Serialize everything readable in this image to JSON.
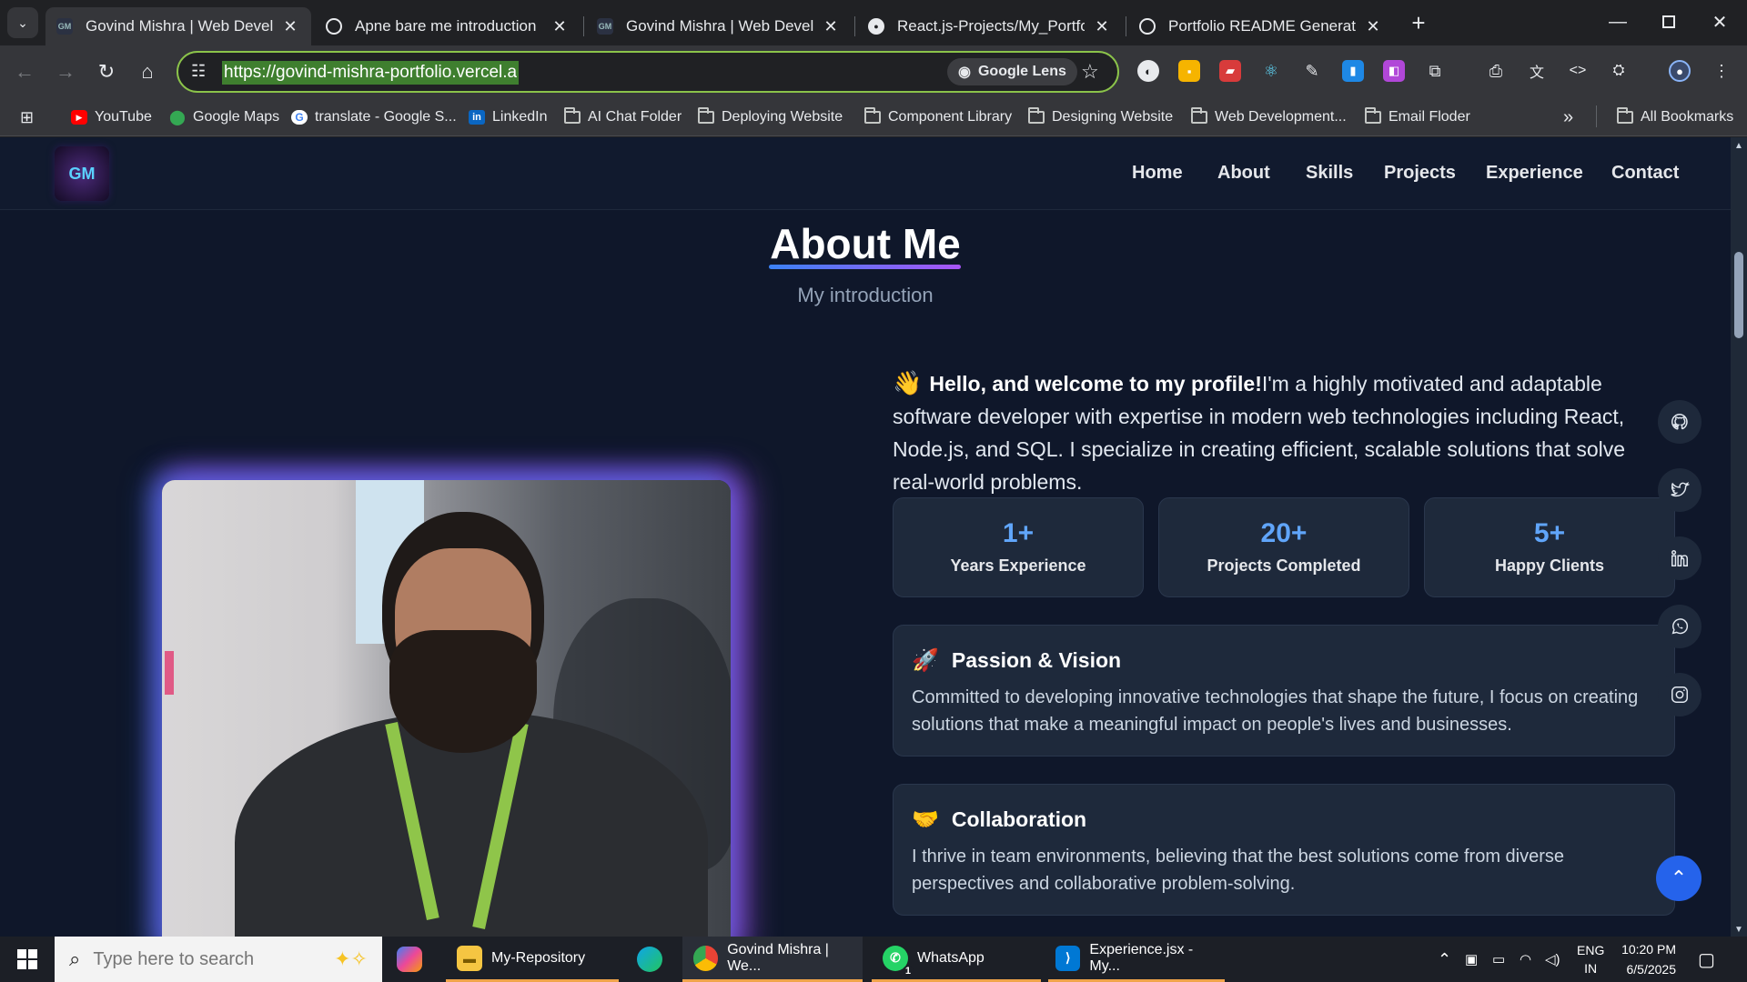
{
  "browser": {
    "tabs": [
      {
        "title": "Govind Mishra | Web Developer",
        "active": true,
        "favicon": "gm-icon"
      },
      {
        "title": "Apne bare me introduction",
        "active": false,
        "favicon": "chatgpt-icon"
      },
      {
        "title": "Govind Mishra | Web Developer",
        "active": false,
        "favicon": "gm-icon"
      },
      {
        "title": "React.js-Projects/My_Portfolio at",
        "active": false,
        "favicon": "github-icon"
      },
      {
        "title": "Portfolio README Generator",
        "active": false,
        "favicon": "chatgpt-icon"
      }
    ],
    "url": "https://govind-mishra-portfolio.vercel.app",
    "lens_label": "Google Lens",
    "bookmarks": [
      "YouTube",
      "Google Maps",
      "translate - Google S...",
      "LinkedIn",
      "AI Chat Folder",
      "Deploying Website",
      "Component Library",
      "Designing Website",
      "Web Development...",
      "Email Floder"
    ],
    "all_bookmarks": "All Bookmarks",
    "more_bookmarks": "»"
  },
  "site": {
    "logo": "GM",
    "nav": [
      "Home",
      "About",
      "Skills",
      "Projects",
      "Experience",
      "Contact"
    ],
    "section_title": "About Me",
    "section_subtitle": "My introduction",
    "intro_emoji": "👋",
    "intro_bold": "Hello, and welcome to my profile!",
    "intro_text": "I'm a highly motivated and adaptable software developer with expertise in modern web technologies including React, Node.js, and SQL. I specialize in creating efficient, scalable solutions that solve real-world problems.",
    "stats": [
      {
        "value": "1+",
        "label": "Years Experience"
      },
      {
        "value": "20+",
        "label": "Projects Completed"
      },
      {
        "value": "5+",
        "label": "Happy Clients"
      }
    ],
    "cards": [
      {
        "emoji": "🚀",
        "title": "Passion & Vision",
        "text": "Committed to developing innovative technologies that shape the future, I focus on creating solutions that make a meaningful impact on people's lives and businesses."
      },
      {
        "emoji": "🤝",
        "title": "Collaboration",
        "text": "I thrive in team environments, believing that the best solutions come from diverse perspectives and collaborative problem-solving."
      }
    ],
    "social": [
      "github-icon",
      "twitter-icon",
      "linkedin-icon",
      "whatsapp-icon",
      "instagram-icon"
    ]
  },
  "taskbar": {
    "search_placeholder": "Type here to search",
    "apps": [
      {
        "label": "My-Repository",
        "icon": "file-explorer-icon"
      },
      {
        "label": "Govind Mishra | We...",
        "icon": "chrome-icon"
      },
      {
        "label": "WhatsApp",
        "icon": "whatsapp-icon",
        "badge": "1"
      },
      {
        "label": "Experience.jsx - My...",
        "icon": "vscode-icon"
      }
    ],
    "lang": "ENG",
    "region": "IN",
    "time": "10:20 PM",
    "date": "6/5/2025"
  },
  "colors": {
    "accent": "#2563eb",
    "page_bg": "#0f172a",
    "card_bg": "#1e293b",
    "stat_value": "#60a5fa"
  }
}
